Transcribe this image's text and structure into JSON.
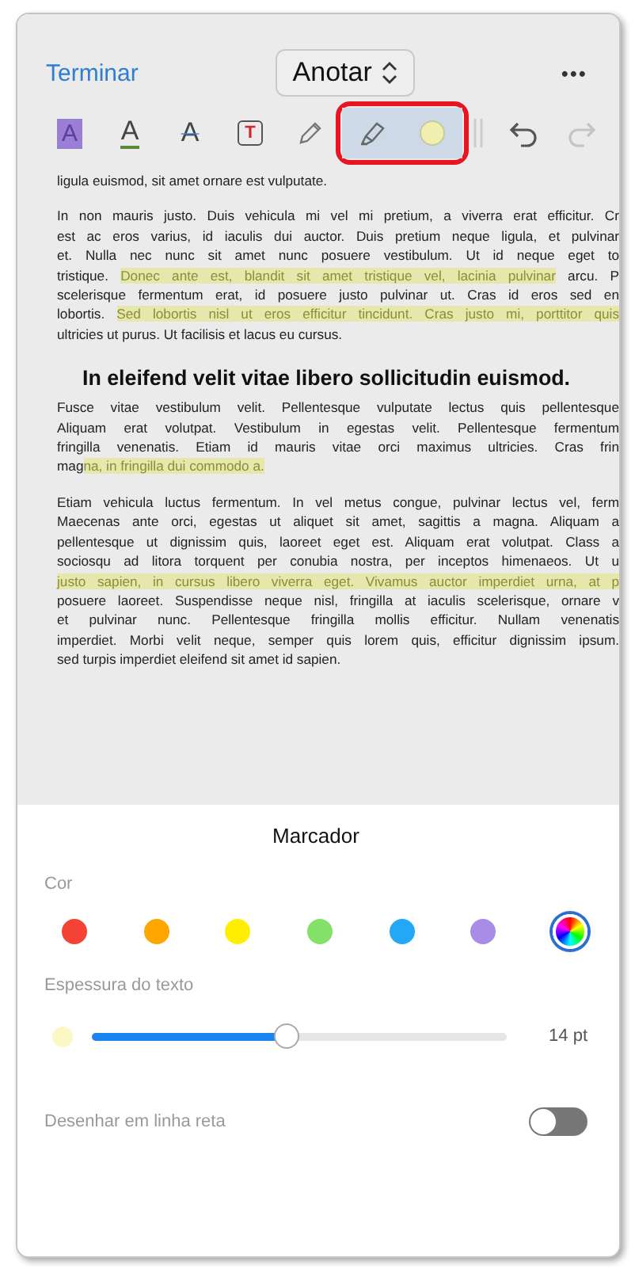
{
  "header": {
    "done": "Terminar",
    "mode": "Anotar",
    "more": "•••"
  },
  "toolbar": {
    "tools": [
      {
        "kind": "text-highlight",
        "label": "A",
        "selected": false
      },
      {
        "kind": "underline",
        "label": "A",
        "selected": false
      },
      {
        "kind": "strikethrough",
        "label": "A",
        "selected": false
      },
      {
        "kind": "textbox",
        "label": "T",
        "selected": false
      },
      {
        "kind": "pencil",
        "selected": false
      },
      {
        "kind": "marker",
        "selected": true
      },
      {
        "kind": "color",
        "color": "#f0efb0",
        "selected": true
      }
    ],
    "history": [
      {
        "kind": "undo",
        "disabled": false
      },
      {
        "kind": "redo",
        "disabled": true
      }
    ]
  },
  "document": [
    {
      "kind": "paragraph",
      "lines": [
        [
          {
            "text": "ligula euismod, sit amet ornare est vulputate.",
            "highlighted": false
          }
        ]
      ]
    },
    {
      "kind": "paragraph",
      "lines": [
        [
          {
            "text": "In non mauris justo. Duis vehicula mi vel mi pretium, a viverra erat efficitur. Cr",
            "highlighted": false
          }
        ],
        [
          {
            "text": "est ac eros varius, id iaculis dui auctor. Duis pretium neque ligula, et pulvinar",
            "highlighted": false
          }
        ],
        [
          {
            "text": "et. Nulla nec nunc sit amet nunc posuere vestibulum. Ut id neque eget to",
            "highlighted": false
          }
        ],
        [
          {
            "text": "tristique. ",
            "highlighted": false
          },
          {
            "text": "Donec ante est, blandit sit amet tristique vel, lacinia pulvinar",
            "highlighted": true
          },
          {
            "text": " arcu. P",
            "highlighted": false
          }
        ],
        [
          {
            "text": "scelerisque fermentum erat, id posuere justo pulvinar ut. Cras id eros sed en",
            "highlighted": false
          }
        ],
        [
          {
            "text": "lobortis. ",
            "highlighted": false
          },
          {
            "text": "Sed lobortis nisl ut eros efficitur tincidunt. Cras justo mi, porttitor quis",
            "highlighted": true
          }
        ],
        [
          {
            "text": "ultricies ut purus. Ut facilisis et lacus eu cursus.",
            "highlighted": false
          }
        ]
      ]
    },
    {
      "kind": "heading",
      "lines": [
        [
          {
            "text": "In eleifend velit vitae libero sollicitudin euismod.",
            "highlighted": false
          }
        ]
      ]
    },
    {
      "kind": "paragraph",
      "lines": [
        [
          {
            "text": "Fusce vitae vestibulum velit. Pellentesque vulputate lectus quis pellentesque",
            "highlighted": false
          }
        ],
        [
          {
            "text": "Aliquam erat volutpat. Vestibulum in egestas velit. Pellentesque fermentum",
            "highlighted": false
          }
        ],
        [
          {
            "text": "fringilla venenatis. Etiam id mauris vitae orci maximus ultricies. Cras frin",
            "highlighted": false
          }
        ],
        [
          {
            "text": "mag",
            "highlighted": false
          },
          {
            "text": "na, in fringilla dui commodo a.",
            "highlighted": true
          }
        ]
      ]
    },
    {
      "kind": "paragraph",
      "lines": [
        [
          {
            "text": "Etiam vehicula luctus fermentum. In vel metus congue, pulvinar lectus vel, ferm",
            "highlighted": false
          }
        ],
        [
          {
            "text": "Maecenas ante orci, egestas ut aliquet sit amet, sagittis a magna. Aliquam a",
            "highlighted": false
          }
        ],
        [
          {
            "text": "pellentesque ut dignissim quis, laoreet eget est. Aliquam erat volutpat. Class a",
            "highlighted": false
          }
        ],
        [
          {
            "text": "sociosqu ad litora torquent per conubia nostra, per inceptos himenaeos. Ut u",
            "highlighted": false
          }
        ],
        [
          {
            "text": "justo sapien, in cursus libero viverra eget. Vivamus auctor imperdiet urna, at p",
            "highlighted": true
          }
        ],
        [
          {
            "text": "posuere laoreet. Suspendisse neque nisl, fringilla at iaculis scelerisque, ornare v",
            "highlighted": false
          }
        ],
        [
          {
            "text": "et pulvinar nunc. Pellentesque fringilla mollis efficitur. Nullam venenatis",
            "highlighted": false
          }
        ],
        [
          {
            "text": "imperdiet. Morbi velit neque, semper quis lorem quis, efficitur dignissim ipsum.",
            "highlighted": false
          }
        ],
        [
          {
            "text": "sed turpis imperdiet eleifend sit amet id sapien.",
            "highlighted": false
          }
        ]
      ]
    }
  ],
  "sheet": {
    "title": "Marcador",
    "color_label": "Cor",
    "colors": [
      {
        "kind": "solid",
        "color": "#f44336",
        "selected": false
      },
      {
        "kind": "solid",
        "color": "#ffa500",
        "selected": false
      },
      {
        "kind": "solid",
        "color": "#ffee00",
        "selected": false
      },
      {
        "kind": "solid",
        "color": "#85e06a",
        "selected": false
      },
      {
        "kind": "solid",
        "color": "#23a8f5",
        "selected": false
      },
      {
        "kind": "solid",
        "color": "#a98ce6",
        "selected": false
      },
      {
        "kind": "spectrum",
        "selected": true
      }
    ],
    "thickness_label": "Espessura do texto",
    "thickness": {
      "level": 0.47,
      "reading": "14 pt"
    },
    "straight_line": {
      "label": "Desenhar em linha reta",
      "on": false
    }
  }
}
